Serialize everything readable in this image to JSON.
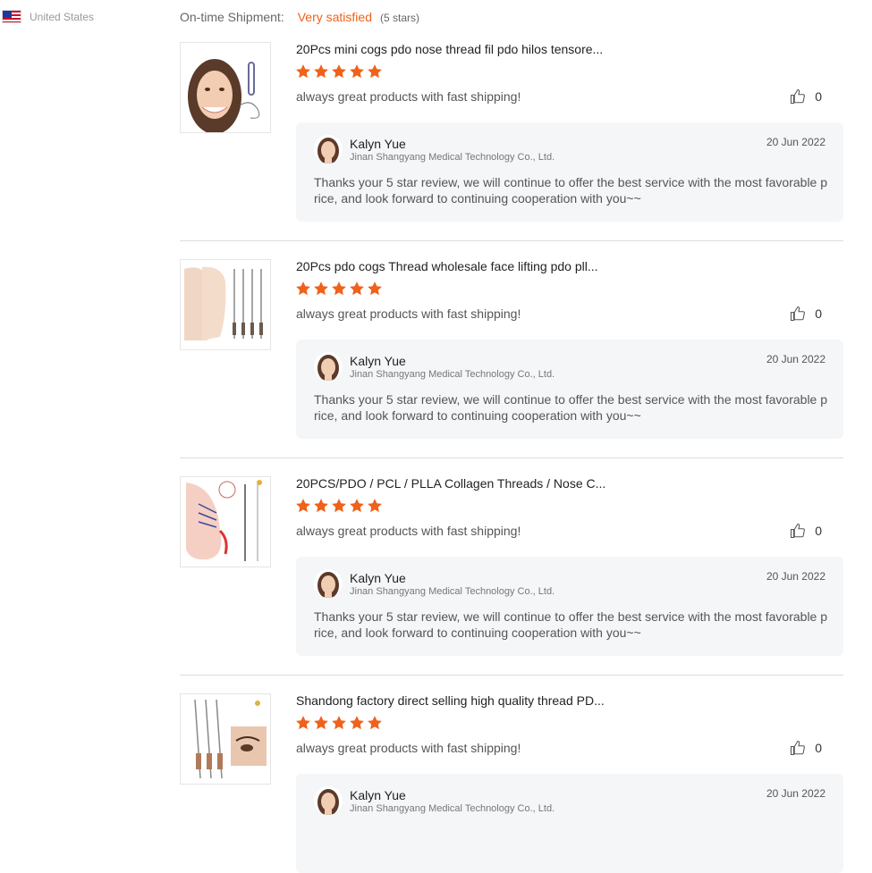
{
  "sidebar": {
    "country": "United States"
  },
  "shipment": {
    "label": "On-time Shipment:",
    "value": "Very satisfied",
    "stars": "(5 stars)"
  },
  "colors": {
    "accent": "#f0611a",
    "star": "#f0611a",
    "reply_bg": "#f5f6f7"
  },
  "reviews": [
    {
      "title": "20Pcs mini cogs pdo nose thread fil pdo hilos tensore...",
      "rating": 5,
      "comment": "always great products with fast shipping!",
      "likes": "0",
      "reply": {
        "name": "Kalyn Yue",
        "company": "Jinan Shangyang Medical Technology Co., Ltd.",
        "date": "20 Jun 2022",
        "text": "Thanks your 5 star review, we will continue to offer the best service with the most favorable price, and look forward to continuing cooperation with you~~"
      }
    },
    {
      "title": "20Pcs pdo cogs Thread wholesale face lifting pdo pll...",
      "rating": 5,
      "comment": "always great products with fast shipping!",
      "likes": "0",
      "reply": {
        "name": "Kalyn Yue",
        "company": "Jinan Shangyang Medical Technology Co., Ltd.",
        "date": "20 Jun 2022",
        "text": "Thanks your 5 star review, we will continue to offer the best service with the most favorable price, and look forward to continuing cooperation with you~~"
      }
    },
    {
      "title": "20PCS/PDO / PCL / PLLA Collagen Threads / Nose C...",
      "rating": 5,
      "comment": "always great products with fast shipping!",
      "likes": "0",
      "reply": {
        "name": "Kalyn Yue",
        "company": "Jinan Shangyang Medical Technology Co., Ltd.",
        "date": "20 Jun 2022",
        "text": "Thanks your 5 star review, we will continue to offer the best service with the most favorable price, and look forward to continuing cooperation with you~~"
      }
    },
    {
      "title": "Shandong factory direct selling high quality thread PD...",
      "rating": 5,
      "comment": "always great products with fast shipping!",
      "likes": "0",
      "reply": {
        "name": "Kalyn Yue",
        "company": "Jinan Shangyang Medical Technology Co., Ltd.",
        "date": "20 Jun 2022",
        "text": ""
      }
    }
  ]
}
